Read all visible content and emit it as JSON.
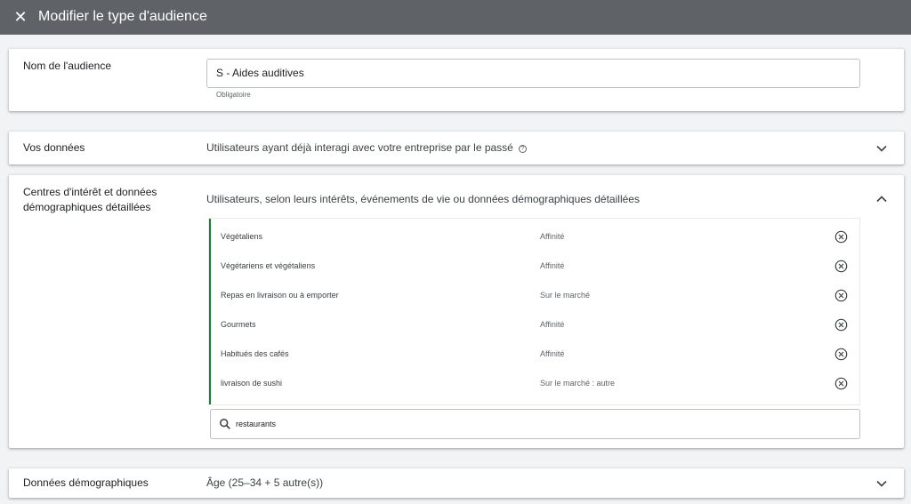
{
  "header": {
    "close_icon": "close-icon",
    "title": "Modifier le type d'audience"
  },
  "audience_name": {
    "label": "Nom de l'audience",
    "value": "S - Aides auditives",
    "helper": "Obligatoire"
  },
  "your_data": {
    "label": "Vos données",
    "summary": "Utilisateurs ayant déjà interagi avec votre entreprise par le passé",
    "help_icon": "help-icon",
    "expanded": false
  },
  "interests": {
    "label_line1": "Centres d'intérêt et données",
    "label_line2": "démographiques détaillées",
    "summary": "Utilisateurs, selon leurs intérêts, événements de vie ou données démographiques détaillées",
    "expanded": true,
    "items": [
      {
        "name": "Végétaliens",
        "type": "Affinité"
      },
      {
        "name": "Végétariens et végétaliens",
        "type": "Affinité"
      },
      {
        "name": "Repas en livraison ou à emporter",
        "type": "Sur le marché"
      },
      {
        "name": "Gourmets",
        "type": "Affinité"
      },
      {
        "name": "Habitués des cafés",
        "type": "Affinité"
      },
      {
        "name": "livraison de sushi",
        "type": "Sur le marché : autre"
      }
    ],
    "search_value": "restaurants"
  },
  "demographics": {
    "label": "Données démographiques",
    "summary": "Âge (25–34 + 5 autre(s))",
    "expanded": false
  },
  "colors": {
    "topbar": "#5f6368",
    "background": "#f1f3f4",
    "accent_bar": "#188038"
  }
}
